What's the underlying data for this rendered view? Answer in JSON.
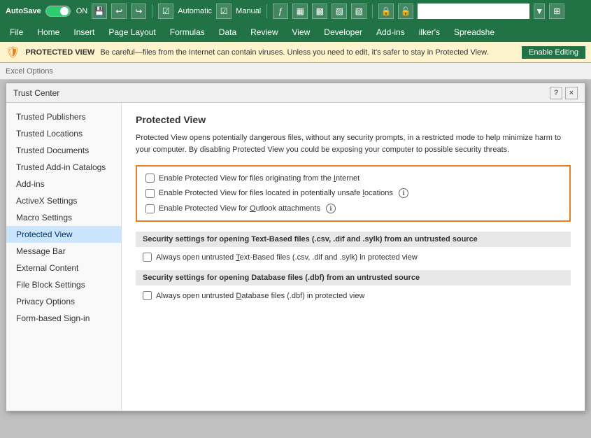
{
  "ribbon": {
    "autosave": "AutoSave",
    "toggle_state": "ON",
    "input_placeholder": "",
    "input_value": ""
  },
  "menu": {
    "items": [
      "File",
      "Home",
      "Insert",
      "Page Layout",
      "Formulas",
      "Data",
      "Review",
      "View",
      "Developer",
      "Add-ins",
      "ilker's",
      "Spreadshe"
    ]
  },
  "protected_bar": {
    "label": "PROTECTED VIEW",
    "text": "Be careful—files from the Internet can contain viruses. Unless you need to edit, it's safer to stay in Protected View.",
    "button": "Enable Editing"
  },
  "excel_options_bar": {
    "title": "Excel Options"
  },
  "dialog": {
    "title": "Trust Center",
    "help_btn": "?",
    "close_btn": "×"
  },
  "sidebar": {
    "items": [
      {
        "id": "trusted-publishers",
        "label": "Trusted Publishers"
      },
      {
        "id": "trusted-locations",
        "label": "Trusted Locations"
      },
      {
        "id": "trusted-documents",
        "label": "Trusted Documents"
      },
      {
        "id": "trusted-add-in-catalogs",
        "label": "Trusted Add-in Catalogs"
      },
      {
        "id": "add-ins",
        "label": "Add-ins"
      },
      {
        "id": "activex-settings",
        "label": "ActiveX Settings"
      },
      {
        "id": "macro-settings",
        "label": "Macro Settings"
      },
      {
        "id": "protected-view",
        "label": "Protected View",
        "active": true
      },
      {
        "id": "message-bar",
        "label": "Message Bar"
      },
      {
        "id": "external-content",
        "label": "External Content"
      },
      {
        "id": "file-block-settings",
        "label": "File Block Settings"
      },
      {
        "id": "privacy-options",
        "label": "Privacy Options"
      },
      {
        "id": "form-based-signin",
        "label": "Form-based Sign-in"
      }
    ]
  },
  "main": {
    "section_title": "Protected View",
    "description": "Protected View opens potentially dangerous files, without any security prompts, in a restricted mode to help minimize harm to your computer. By disabling Protected View you could be exposing your computer to possible security threats.",
    "checkbox_group": {
      "checkboxes": [
        {
          "id": "pv-internet",
          "label": "Enable Protected View for files originating from the Internet",
          "underline_start": 42,
          "checked": false
        },
        {
          "id": "pv-unsafe-locations",
          "label": "Enable Protected View for files located in potentially unsafe locations",
          "has_info": true,
          "checked": false
        },
        {
          "id": "pv-outlook",
          "label": "Enable Protected View for Outlook attachments",
          "has_info": true,
          "checked": false
        }
      ]
    },
    "text_based_section": {
      "header": "Security settings for opening Text-Based files (.csv, .dif and .sylk) from an untrusted source",
      "checkboxes": [
        {
          "id": "tb-always-open",
          "label": "Always open untrusted Text-Based files (.csv, .dif and .sylk) in protected view",
          "checked": false
        }
      ]
    },
    "database_section": {
      "header": "Security settings for opening Database files (.dbf) from an untrusted source",
      "checkboxes": [
        {
          "id": "db-always-open",
          "label": "Always open untrusted Database files (.dbf) in protected view",
          "checked": false
        }
      ]
    }
  }
}
